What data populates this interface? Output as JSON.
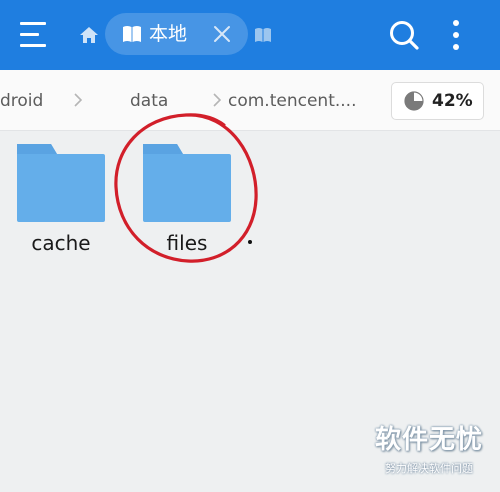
{
  "appbar": {
    "tab_label": "本地",
    "icons": [
      "menu-icon",
      "home-icon",
      "book-icon",
      "close-icon",
      "next-tab-icon",
      "search-icon",
      "more-vert-icon"
    ],
    "colors": {
      "bar": "#1f7ee0",
      "foreground": "#ffffff"
    }
  },
  "breadcrumb": {
    "items": [
      "droid",
      "data",
      "com.tencent...."
    ],
    "storage_usage": "42%"
  },
  "folders": [
    {
      "name": "cache"
    },
    {
      "name": "files"
    }
  ],
  "annotation": {
    "shape": "ellipse",
    "target": "files",
    "color": "#d21f2a"
  },
  "watermark": {
    "title": "软件无忧",
    "subtitle": "努力解决软件问题"
  },
  "colors": {
    "folder": "#64aeea",
    "folder_tab": "#5ea8e6",
    "background": "#eef0f1"
  }
}
